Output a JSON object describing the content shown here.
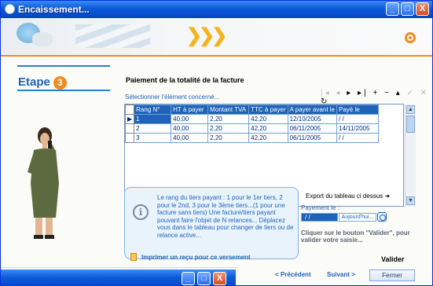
{
  "window": {
    "title": "Encaissement...",
    "controls": {
      "minimize": "_",
      "maximize": "□",
      "close": "X"
    }
  },
  "sidebar": {
    "step_label": "Etape",
    "step_number": "3"
  },
  "main": {
    "heading": "Paiement de la totalité de la facture",
    "select_hint": "Sélectionner l'élément concerné...",
    "toolbar": {
      "first": "|◂",
      "prev": "◂",
      "next": "▸",
      "last": "▸|",
      "add": "+",
      "remove": "−",
      "up": "▴",
      "check": "✓",
      "cancel": "✕",
      "refresh": "↻"
    },
    "table": {
      "columns": [
        "Rang N°",
        "HT à payer",
        "Montant TVA",
        "TTC à payer",
        "A payer avant le",
        "Payé le"
      ],
      "rows": [
        [
          "1",
          "40,00",
          "2,20",
          "42,20",
          "12/10/2005",
          " / /"
        ],
        [
          "2",
          "40,00",
          "2,20",
          "42,20",
          "06/11/2005",
          "14/11/2005"
        ],
        [
          "3",
          "40,00",
          "2,20",
          "42,20",
          "06/11/2005",
          " / /"
        ]
      ],
      "selected_row": 0
    },
    "info_text": "Le rang du tiers payant : 1 pour le 1er tiers, 2 pour le 2nd, 3 pour le 3ème tiers...(1 pour une facture sans tiers) Une facture/tiers payant pouvant faire l'objet de N relances... Déplacez vous dans le tableau pour changer de tiers ou de relance active...",
    "export_label": "Export du tableau ci dessus ➜",
    "payment_label": "Payement le :",
    "payment_date": " / /",
    "today_button": "Aujourd'hui...",
    "validate_hint": "Cliquer sur le bouton \"Valider\", pour valider votre saisie...",
    "print_label": "Imprimer un reçu  pour ce versement",
    "validate_label": "Valider"
  },
  "footer": {
    "previous": "< Précédent",
    "next": "Suivant >",
    "close": "Fermer"
  },
  "colors": {
    "accent": "#1e63b8",
    "orange": "#f08a20",
    "titlebar": "#0a5ad8"
  }
}
